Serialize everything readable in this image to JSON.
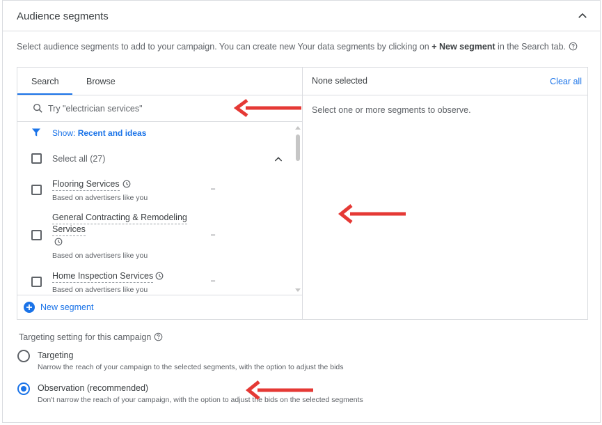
{
  "section": {
    "title": "Audience segments",
    "description_pre": "Select audience segments to add to your campaign. You can create new Your data segments by clicking on ",
    "description_bold": "+ New segment",
    "description_post": " in the Search tab."
  },
  "tabs": {
    "search": "Search",
    "browse": "Browse"
  },
  "search": {
    "placeholder": "Try \"electrician services\""
  },
  "filter": {
    "prefix": "Show: ",
    "value": "Recent and ideas"
  },
  "select_all": {
    "label": "Select all (27)"
  },
  "items": [
    {
      "name": "Flooring Services",
      "sub": "Based on advertisers like you",
      "value": "–"
    },
    {
      "name_line1": "General Contracting & Remodeling",
      "name_line2": "Services",
      "sub": "Based on advertisers like you",
      "value": "–"
    },
    {
      "name": "Home Inspection Services",
      "sub": "Based on advertisers like you",
      "value": "–"
    }
  ],
  "new_segment": {
    "label": "New segment"
  },
  "right_panel": {
    "status": "None selected",
    "clear_all": "Clear all",
    "hint": "Select one or more segments to observe."
  },
  "targeting": {
    "heading": "Targeting setting for this campaign",
    "options": [
      {
        "label": "Targeting",
        "desc": "Narrow the reach of your campaign to the selected segments, with the option to adjust the bids",
        "selected": false
      },
      {
        "label": "Observation (recommended)",
        "desc": "Don't narrow the reach of your campaign, with the option to adjust the bids on the selected segments",
        "selected": true
      }
    ]
  },
  "colors": {
    "accent": "#1a73e8",
    "annotation_arrow": "#e53935",
    "border": "#dadce0"
  },
  "icons": [
    "chevron-up-icon",
    "help-icon",
    "search-icon",
    "filter-icon",
    "clock-icon",
    "plus-circle-icon",
    "annotation-arrow"
  ]
}
